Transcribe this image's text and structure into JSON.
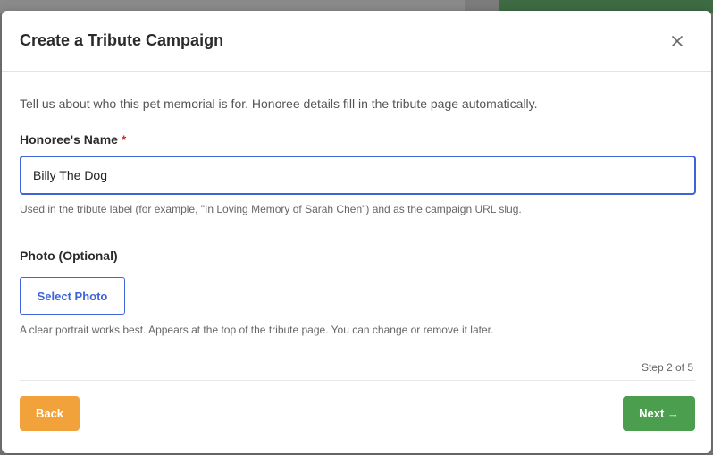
{
  "modal": {
    "title": "Create a Tribute Campaign",
    "close_icon": "close-icon",
    "intro": "Tell us about who this pet memorial is for. Honoree details fill in the tribute page automatically."
  },
  "honoree": {
    "label": "Honoree's Name",
    "required_mark": "*",
    "value": "Billy The Dog",
    "help": "Used in the tribute label (for example, \"In Loving Memory of Sarah Chen\") and as the campaign URL slug."
  },
  "photo": {
    "label": "Photo (Optional)",
    "button_label": "Select Photo",
    "help": "A clear portrait works best. Appears at the top of the tribute page. You can change or remove it later."
  },
  "progress": {
    "step_text": "Step 2 of 5"
  },
  "footer": {
    "back_label": "Back",
    "next_label": "Next →"
  },
  "colors": {
    "accent_blue": "#3f63d8",
    "back_orange": "#f2a23a",
    "next_green": "#4a9e4d",
    "required_red": "#d12b2b"
  }
}
